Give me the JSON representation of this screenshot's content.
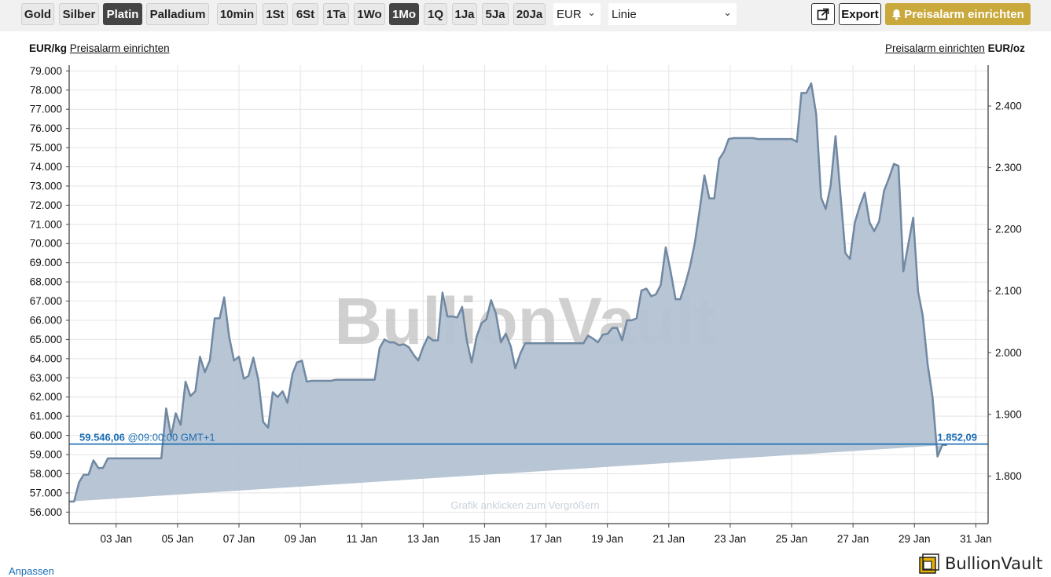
{
  "toolbar": {
    "metals": [
      "Gold",
      "Silber",
      "Platin",
      "Palladium"
    ],
    "active_metal": "Platin",
    "ranges": [
      "10min",
      "1St",
      "6St",
      "1Ta",
      "1Wo",
      "1Mo",
      "1Q",
      "1Ja",
      "5Ja",
      "20Ja"
    ],
    "active_range": "1Mo",
    "currency": "EUR",
    "chart_style": "Linie",
    "export_label": "Export",
    "alarm_label": "Preisalarm einrichten"
  },
  "left_label": {
    "unit": "EUR/kg",
    "link": "Preisalarm einrichten"
  },
  "right_label": {
    "link": "Preisalarm einrichten",
    "unit": "EUR/oz"
  },
  "current_price": {
    "kg": "59.546,06",
    "time": "@09:00:00 GMT+1",
    "oz": "1.852,09"
  },
  "watermark": "BullionVault",
  "hint": "Grafik anklicken zum Vergrößern",
  "anpassen": "Anpassen",
  "logo": "BullionVault",
  "colors": {
    "line": "#7088a2",
    "fill": "#b3c2d2",
    "price_line": "#1a6db5",
    "alarm": "#c9a83c",
    "active": "#444444"
  },
  "chart_data": {
    "type": "area",
    "title": "",
    "xlabel": "",
    "ylabel": "EUR/kg",
    "y2label": "EUR/oz",
    "ylim": [
      55400,
      79300
    ],
    "y2lim": [
      1722.88,
      2466.23
    ],
    "y_ticks": [
      "56.000",
      "57.000",
      "58.000",
      "59.000",
      "60.000",
      "61.000",
      "62.000",
      "63.000",
      "64.000",
      "65.000",
      "66.000",
      "67.000",
      "68.000",
      "69.000",
      "70.000",
      "71.000",
      "72.000",
      "73.000",
      "74.000",
      "75.000",
      "76.000",
      "77.000",
      "78.000",
      "79.000"
    ],
    "y2_ticks": [
      "1.800",
      "1.900",
      "2.000",
      "2.100",
      "2.200",
      "2.300",
      "2.400"
    ],
    "x_ticks": [
      "03 Jan",
      "05 Jan",
      "07 Jan",
      "09 Jan",
      "11 Jan",
      "13 Jan",
      "15 Jan",
      "17 Jan",
      "19 Jan",
      "21 Jan",
      "23 Jan",
      "25 Jan",
      "27 Jan",
      "29 Jan",
      "31 Jan"
    ],
    "x_tick_days": [
      3,
      5,
      7,
      9,
      11,
      13,
      15,
      17,
      19,
      21,
      23,
      25,
      27,
      29,
      31
    ],
    "xlim": [
      1.47,
      31.4
    ],
    "grid": true,
    "x_day": [
      1.47,
      1.63,
      1.79,
      1.94,
      2.1,
      2.26,
      2.42,
      2.57,
      2.73,
      2.89,
      3.05,
      3.21,
      3.36,
      3.52,
      3.68,
      3.84,
      4.0,
      4.15,
      4.31,
      4.47,
      4.63,
      4.79,
      4.94,
      5.1,
      5.26,
      5.42,
      5.58,
      5.73,
      5.89,
      6.05,
      6.21,
      6.37,
      6.52,
      6.68,
      6.84,
      7.0,
      7.16,
      7.31,
      7.47,
      7.63,
      7.79,
      7.95,
      8.1,
      8.26,
      8.42,
      8.58,
      8.74,
      8.89,
      9.05,
      9.21,
      9.37,
      9.53,
      9.68,
      9.84,
      10.0,
      10.16,
      10.32,
      10.47,
      10.63,
      10.79,
      10.95,
      11.11,
      11.26,
      11.42,
      11.58,
      11.74,
      11.9,
      12.05,
      12.21,
      12.37,
      12.53,
      12.69,
      12.84,
      13.0,
      13.16,
      13.32,
      13.48,
      13.63,
      13.79,
      13.95,
      14.11,
      14.27,
      14.42,
      14.58,
      14.74,
      14.9,
      15.06,
      15.21,
      15.37,
      15.53,
      15.69,
      15.85,
      16.0,
      16.16,
      16.32,
      16.48,
      16.64,
      16.79,
      16.95,
      17.11,
      17.27,
      17.43,
      17.58,
      17.74,
      17.9,
      18.06,
      18.22,
      18.37,
      18.53,
      18.69,
      18.85,
      19.01,
      19.16,
      19.32,
      19.48,
      19.64,
      19.79,
      19.95,
      20.11,
      20.27,
      20.43,
      20.58,
      20.74,
      20.9,
      21.06,
      21.22,
      21.37,
      21.53,
      21.69,
      21.85,
      22.01,
      22.16,
      22.32,
      22.48,
      22.64,
      22.8,
      22.95,
      23.11,
      23.27,
      23.43,
      23.59,
      23.74,
      23.9,
      24.06,
      24.22,
      24.38,
      24.53,
      24.69,
      24.85,
      25.01,
      25.17,
      25.32,
      25.48,
      25.64,
      25.8,
      25.96,
      26.11,
      26.27,
      26.43,
      26.59,
      26.75,
      26.9,
      27.06,
      27.22,
      27.38,
      27.54,
      27.69,
      27.85,
      28.01,
      28.17,
      28.33,
      28.48,
      28.64,
      28.8,
      28.96,
      29.12,
      29.27,
      29.43,
      29.59,
      29.75,
      29.91,
      30.06,
      30.22,
      30.38,
      30.54,
      30.7,
      30.85,
      31.01,
      31.17,
      31.33
    ],
    "values": [
      56550,
      56550,
      57550,
      57950,
      57950,
      58700,
      58300,
      58300,
      58800,
      58800,
      58800,
      58800,
      58800,
      58800,
      58800,
      58800,
      58800,
      58800,
      58800,
      58800,
      61400,
      59950,
      61150,
      60550,
      62800,
      62050,
      62300,
      64100,
      63300,
      63900,
      66100,
      66100,
      67200,
      65150,
      63900,
      64100,
      62950,
      63100,
      64050,
      62900,
      60700,
      60400,
      62250,
      62000,
      62300,
      61700,
      63200,
      63800,
      63900,
      62800,
      62850,
      62850,
      62850,
      62850,
      62850,
      62900,
      62900,
      62900,
      62900,
      62900,
      62900,
      62900,
      62900,
      62900,
      64550,
      65000,
      64850,
      64850,
      64700,
      64750,
      64600,
      64200,
      63900,
      64600,
      65150,
      64950,
      64950,
      67450,
      66200,
      66200,
      66150,
      66700,
      64950,
      63800,
      65150,
      65850,
      66050,
      67050,
      66350,
      64850,
      65300,
      64650,
      63500,
      64250,
      64800,
      64800,
      64800,
      64800,
      64800,
      64800,
      64800,
      64800,
      64800,
      64800,
      64800,
      64800,
      64800,
      65200,
      65050,
      64850,
      65250,
      65300,
      65600,
      65600,
      64950,
      66000,
      66000,
      66100,
      67550,
      67650,
      67250,
      67350,
      67850,
      69800,
      68550,
      67100,
      67100,
      67850,
      68800,
      70050,
      71800,
      73550,
      72350,
      72350,
      74400,
      74800,
      75450,
      75500,
      75500,
      75500,
      75500,
      75500,
      75450,
      75450,
      75450,
      75450,
      75450,
      75450,
      75450,
      75450,
      75300,
      77850,
      77850,
      78350,
      76750,
      72400,
      71800,
      73000,
      75600,
      72600,
      69500,
      69200,
      71100,
      71950,
      72650,
      71100,
      70650,
      71150,
      72750,
      73400,
      74150,
      74050,
      68550,
      69950,
      71350,
      67500,
      66250,
      63700,
      62000,
      58900,
      59500,
      59500
    ]
  }
}
